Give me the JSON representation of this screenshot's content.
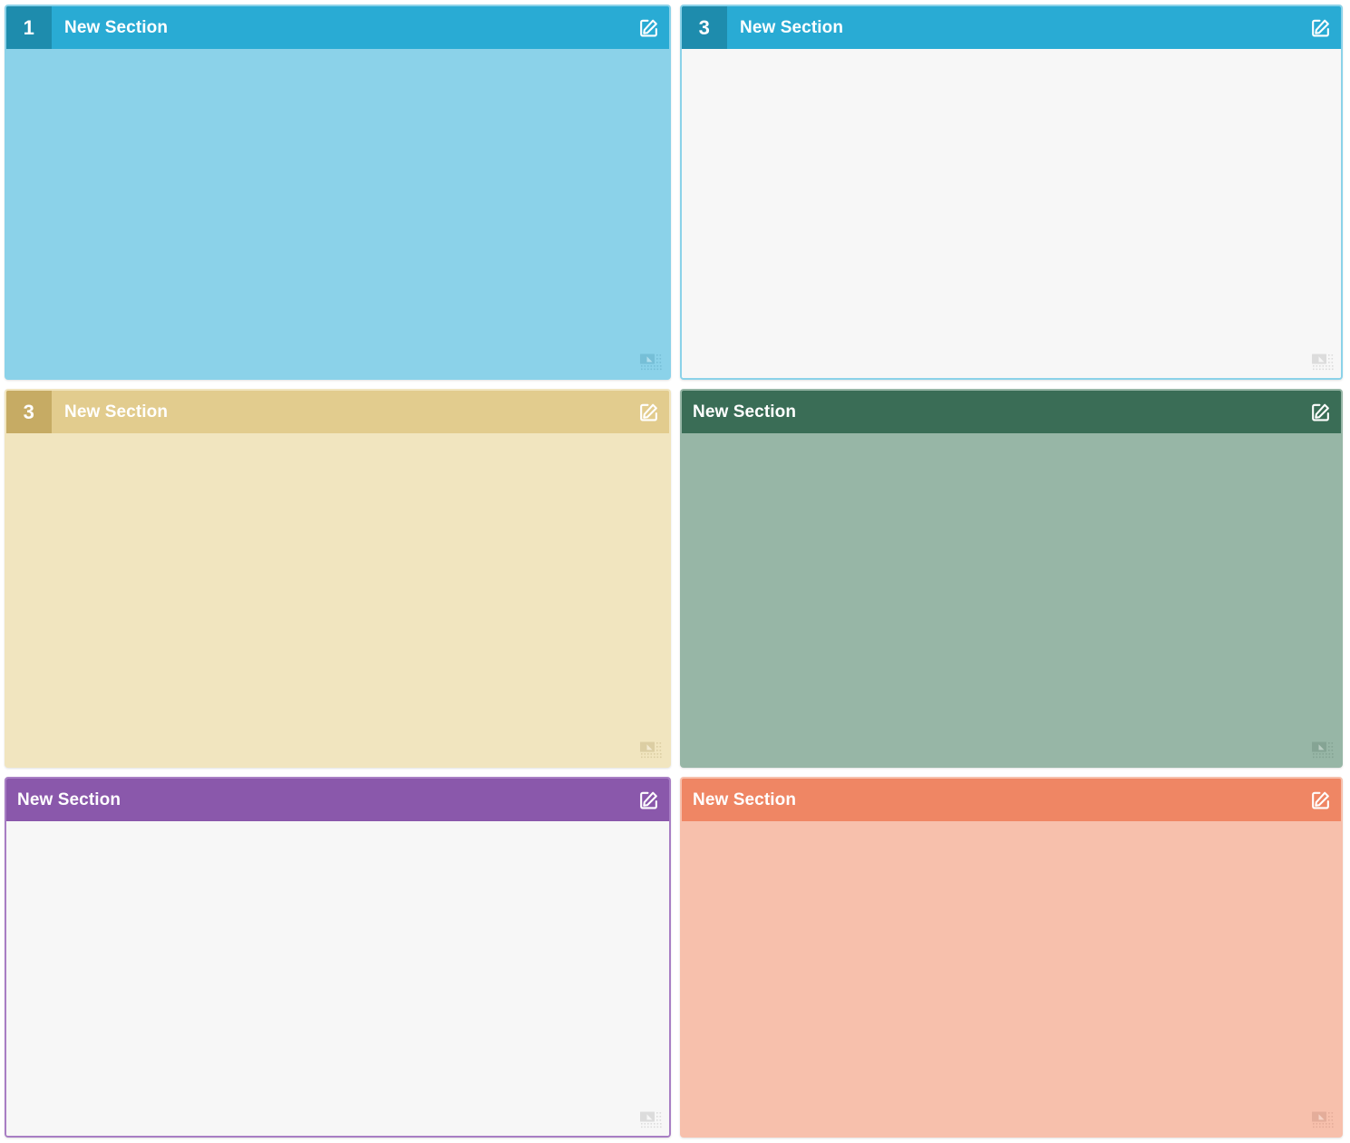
{
  "page": {
    "background": "#ffffff",
    "layout": "2-column grid of section cards, 3 rows"
  },
  "icons": {
    "edit": "edit-pencil-square-icon",
    "resize": "resize-grip-icon"
  },
  "panels": [
    {
      "id": "panel-1",
      "badge": "1",
      "has_badge": true,
      "title": "New Section",
      "header_color": "#29abd4",
      "badge_color": "#1e8cad",
      "body_color": "#8bd2e9",
      "border_color": "#8bd2e9",
      "grip_color": "#5ba6c0",
      "edit_label": "Edit section",
      "resize_label": "Resize section"
    },
    {
      "id": "panel-2",
      "badge": "3",
      "has_badge": true,
      "title": "New Section",
      "header_color": "#29abd4",
      "badge_color": "#1e8cad",
      "body_color": "#f7f7f7",
      "border_color": "#8bd2e9",
      "grip_color": "#b8b8b8",
      "edit_label": "Edit section",
      "resize_label": "Resize section"
    },
    {
      "id": "panel-3",
      "badge": "3",
      "has_badge": true,
      "title": "New Section",
      "header_color": "#e2cc8e",
      "badge_color": "#c6ab64",
      "body_color": "#f1e5bf",
      "border_color": "#f1e5bf",
      "grip_color": "#c0b07e",
      "edit_label": "Edit section",
      "resize_label": "Resize section"
    },
    {
      "id": "panel-4",
      "badge": "",
      "has_badge": false,
      "title": "New Section",
      "header_color": "#3a6d56",
      "badge_color": "#2d5644",
      "body_color": "#97b6a6",
      "border_color": "#97b6a6",
      "grip_color": "#6d8d7c",
      "edit_label": "Edit section",
      "resize_label": "Resize section"
    },
    {
      "id": "panel-5",
      "badge": "",
      "has_badge": false,
      "title": "New Section",
      "header_color": "#8a58ab",
      "badge_color": "#6f4589",
      "body_color": "#f7f7f7",
      "border_color": "#a87ec4",
      "grip_color": "#b8b8b8",
      "edit_label": "Edit section",
      "resize_label": "Resize section"
    },
    {
      "id": "panel-6",
      "badge": "",
      "has_badge": false,
      "title": "New Section",
      "header_color": "#ef8664",
      "badge_color": "#d66d4c",
      "body_color": "#f7c0ac",
      "border_color": "#f7c0ac",
      "grip_color": "#cb9582",
      "edit_label": "Edit section",
      "resize_label": "Resize section"
    }
  ]
}
